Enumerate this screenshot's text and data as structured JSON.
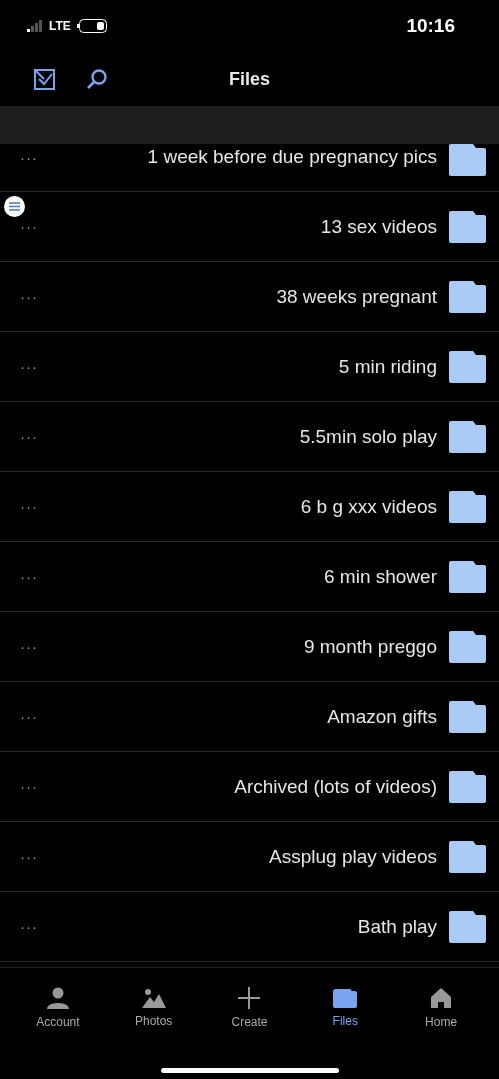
{
  "status_bar": {
    "time": "10:16",
    "network": "LTE"
  },
  "header": {
    "title": "Files"
  },
  "folders": [
    {
      "name": "1 week before due pregnancy pics"
    },
    {
      "name": "13 sex videos"
    },
    {
      "name": "38 weeks pregnant"
    },
    {
      "name": "5 min riding"
    },
    {
      "name": "5.5min solo play"
    },
    {
      "name": "6 b g xxx videos"
    },
    {
      "name": "6 min shower"
    },
    {
      "name": "9 month preggo"
    },
    {
      "name": "Amazon gifts"
    },
    {
      "name": "Archived (lots of videos)"
    },
    {
      "name": "Assplug play videos"
    },
    {
      "name": "Bath play"
    }
  ],
  "more_label": "···",
  "nav": [
    {
      "label": "Account",
      "kind": "account",
      "selected": false
    },
    {
      "label": "Photos",
      "kind": "photos",
      "selected": false
    },
    {
      "label": "Create",
      "kind": "create",
      "selected": false
    },
    {
      "label": "Files",
      "kind": "files",
      "selected": true
    },
    {
      "label": "Home",
      "kind": "home",
      "selected": false
    }
  ]
}
